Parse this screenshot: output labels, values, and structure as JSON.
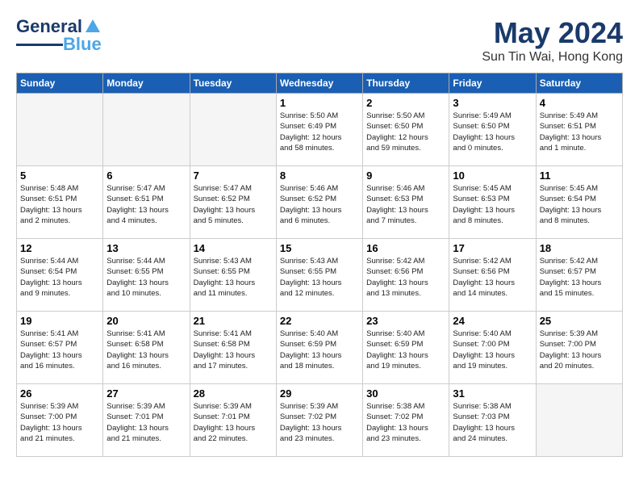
{
  "header": {
    "logo_line1": "General",
    "logo_line2": "Blue",
    "month_title": "May 2024",
    "location": "Sun Tin Wai, Hong Kong"
  },
  "weekdays": [
    "Sunday",
    "Monday",
    "Tuesday",
    "Wednesday",
    "Thursday",
    "Friday",
    "Saturday"
  ],
  "weeks": [
    [
      {
        "num": "",
        "info": "",
        "empty": true
      },
      {
        "num": "",
        "info": "",
        "empty": true
      },
      {
        "num": "",
        "info": "",
        "empty": true
      },
      {
        "num": "1",
        "info": "Sunrise: 5:50 AM\nSunset: 6:49 PM\nDaylight: 12 hours\nand 58 minutes."
      },
      {
        "num": "2",
        "info": "Sunrise: 5:50 AM\nSunset: 6:50 PM\nDaylight: 12 hours\nand 59 minutes."
      },
      {
        "num": "3",
        "info": "Sunrise: 5:49 AM\nSunset: 6:50 PM\nDaylight: 13 hours\nand 0 minutes."
      },
      {
        "num": "4",
        "info": "Sunrise: 5:49 AM\nSunset: 6:51 PM\nDaylight: 13 hours\nand 1 minute."
      }
    ],
    [
      {
        "num": "5",
        "info": "Sunrise: 5:48 AM\nSunset: 6:51 PM\nDaylight: 13 hours\nand 2 minutes."
      },
      {
        "num": "6",
        "info": "Sunrise: 5:47 AM\nSunset: 6:51 PM\nDaylight: 13 hours\nand 4 minutes."
      },
      {
        "num": "7",
        "info": "Sunrise: 5:47 AM\nSunset: 6:52 PM\nDaylight: 13 hours\nand 5 minutes."
      },
      {
        "num": "8",
        "info": "Sunrise: 5:46 AM\nSunset: 6:52 PM\nDaylight: 13 hours\nand 6 minutes."
      },
      {
        "num": "9",
        "info": "Sunrise: 5:46 AM\nSunset: 6:53 PM\nDaylight: 13 hours\nand 7 minutes."
      },
      {
        "num": "10",
        "info": "Sunrise: 5:45 AM\nSunset: 6:53 PM\nDaylight: 13 hours\nand 8 minutes."
      },
      {
        "num": "11",
        "info": "Sunrise: 5:45 AM\nSunset: 6:54 PM\nDaylight: 13 hours\nand 8 minutes."
      }
    ],
    [
      {
        "num": "12",
        "info": "Sunrise: 5:44 AM\nSunset: 6:54 PM\nDaylight: 13 hours\nand 9 minutes."
      },
      {
        "num": "13",
        "info": "Sunrise: 5:44 AM\nSunset: 6:55 PM\nDaylight: 13 hours\nand 10 minutes."
      },
      {
        "num": "14",
        "info": "Sunrise: 5:43 AM\nSunset: 6:55 PM\nDaylight: 13 hours\nand 11 minutes."
      },
      {
        "num": "15",
        "info": "Sunrise: 5:43 AM\nSunset: 6:55 PM\nDaylight: 13 hours\nand 12 minutes."
      },
      {
        "num": "16",
        "info": "Sunrise: 5:42 AM\nSunset: 6:56 PM\nDaylight: 13 hours\nand 13 minutes."
      },
      {
        "num": "17",
        "info": "Sunrise: 5:42 AM\nSunset: 6:56 PM\nDaylight: 13 hours\nand 14 minutes."
      },
      {
        "num": "18",
        "info": "Sunrise: 5:42 AM\nSunset: 6:57 PM\nDaylight: 13 hours\nand 15 minutes."
      }
    ],
    [
      {
        "num": "19",
        "info": "Sunrise: 5:41 AM\nSunset: 6:57 PM\nDaylight: 13 hours\nand 16 minutes."
      },
      {
        "num": "20",
        "info": "Sunrise: 5:41 AM\nSunset: 6:58 PM\nDaylight: 13 hours\nand 16 minutes."
      },
      {
        "num": "21",
        "info": "Sunrise: 5:41 AM\nSunset: 6:58 PM\nDaylight: 13 hours\nand 17 minutes."
      },
      {
        "num": "22",
        "info": "Sunrise: 5:40 AM\nSunset: 6:59 PM\nDaylight: 13 hours\nand 18 minutes."
      },
      {
        "num": "23",
        "info": "Sunrise: 5:40 AM\nSunset: 6:59 PM\nDaylight: 13 hours\nand 19 minutes."
      },
      {
        "num": "24",
        "info": "Sunrise: 5:40 AM\nSunset: 7:00 PM\nDaylight: 13 hours\nand 19 minutes."
      },
      {
        "num": "25",
        "info": "Sunrise: 5:39 AM\nSunset: 7:00 PM\nDaylight: 13 hours\nand 20 minutes."
      }
    ],
    [
      {
        "num": "26",
        "info": "Sunrise: 5:39 AM\nSunset: 7:00 PM\nDaylight: 13 hours\nand 21 minutes."
      },
      {
        "num": "27",
        "info": "Sunrise: 5:39 AM\nSunset: 7:01 PM\nDaylight: 13 hours\nand 21 minutes."
      },
      {
        "num": "28",
        "info": "Sunrise: 5:39 AM\nSunset: 7:01 PM\nDaylight: 13 hours\nand 22 minutes."
      },
      {
        "num": "29",
        "info": "Sunrise: 5:39 AM\nSunset: 7:02 PM\nDaylight: 13 hours\nand 23 minutes."
      },
      {
        "num": "30",
        "info": "Sunrise: 5:38 AM\nSunset: 7:02 PM\nDaylight: 13 hours\nand 23 minutes."
      },
      {
        "num": "31",
        "info": "Sunrise: 5:38 AM\nSunset: 7:03 PM\nDaylight: 13 hours\nand 24 minutes."
      },
      {
        "num": "",
        "info": "",
        "empty": true
      }
    ]
  ]
}
